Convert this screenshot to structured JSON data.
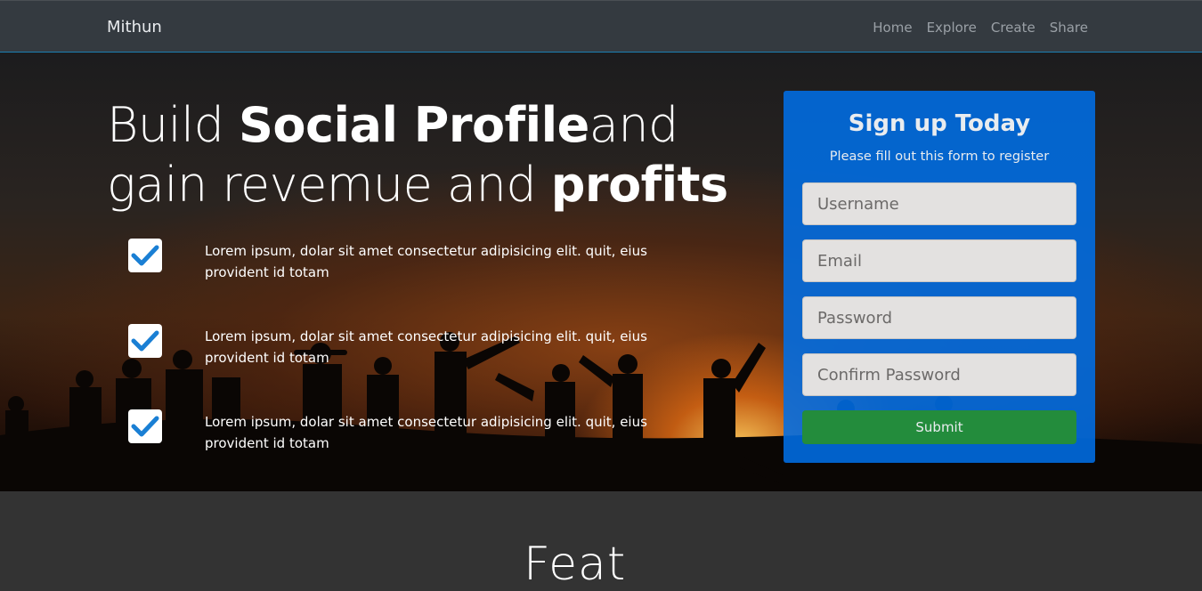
{
  "nav": {
    "brand": "Mithun",
    "links": [
      "Home",
      "Explore",
      "Create",
      "Share"
    ]
  },
  "hero": {
    "headline_part1": "Build ",
    "headline_bold1": "Social Profile",
    "headline_part2": "and gain revemue and ",
    "headline_bold2": "profits",
    "features": [
      "Lorem ipsum, dolar sit amet consectetur adipisicing elit. quit, eius provident id totam",
      "Lorem ipsum, dolar sit amet consectetur adipisicing elit. quit, eius provident id totam",
      "Lorem ipsum, dolar sit amet consectetur adipisicing elit. quit, eius provident id totam"
    ]
  },
  "signup": {
    "title": "Sign up Today",
    "subtitle": "Please fill out this form to register",
    "username_placeholder": "Username",
    "email_placeholder": "Email",
    "password_placeholder": "Password",
    "confirm_placeholder": "Confirm Password",
    "submit_label": "Submit"
  },
  "section": {
    "title_partial": "Feat"
  },
  "colors": {
    "navbar": "#343a40",
    "form_bg": "#006ee6",
    "submit": "#238c3c",
    "check": "#1a7fd4"
  }
}
